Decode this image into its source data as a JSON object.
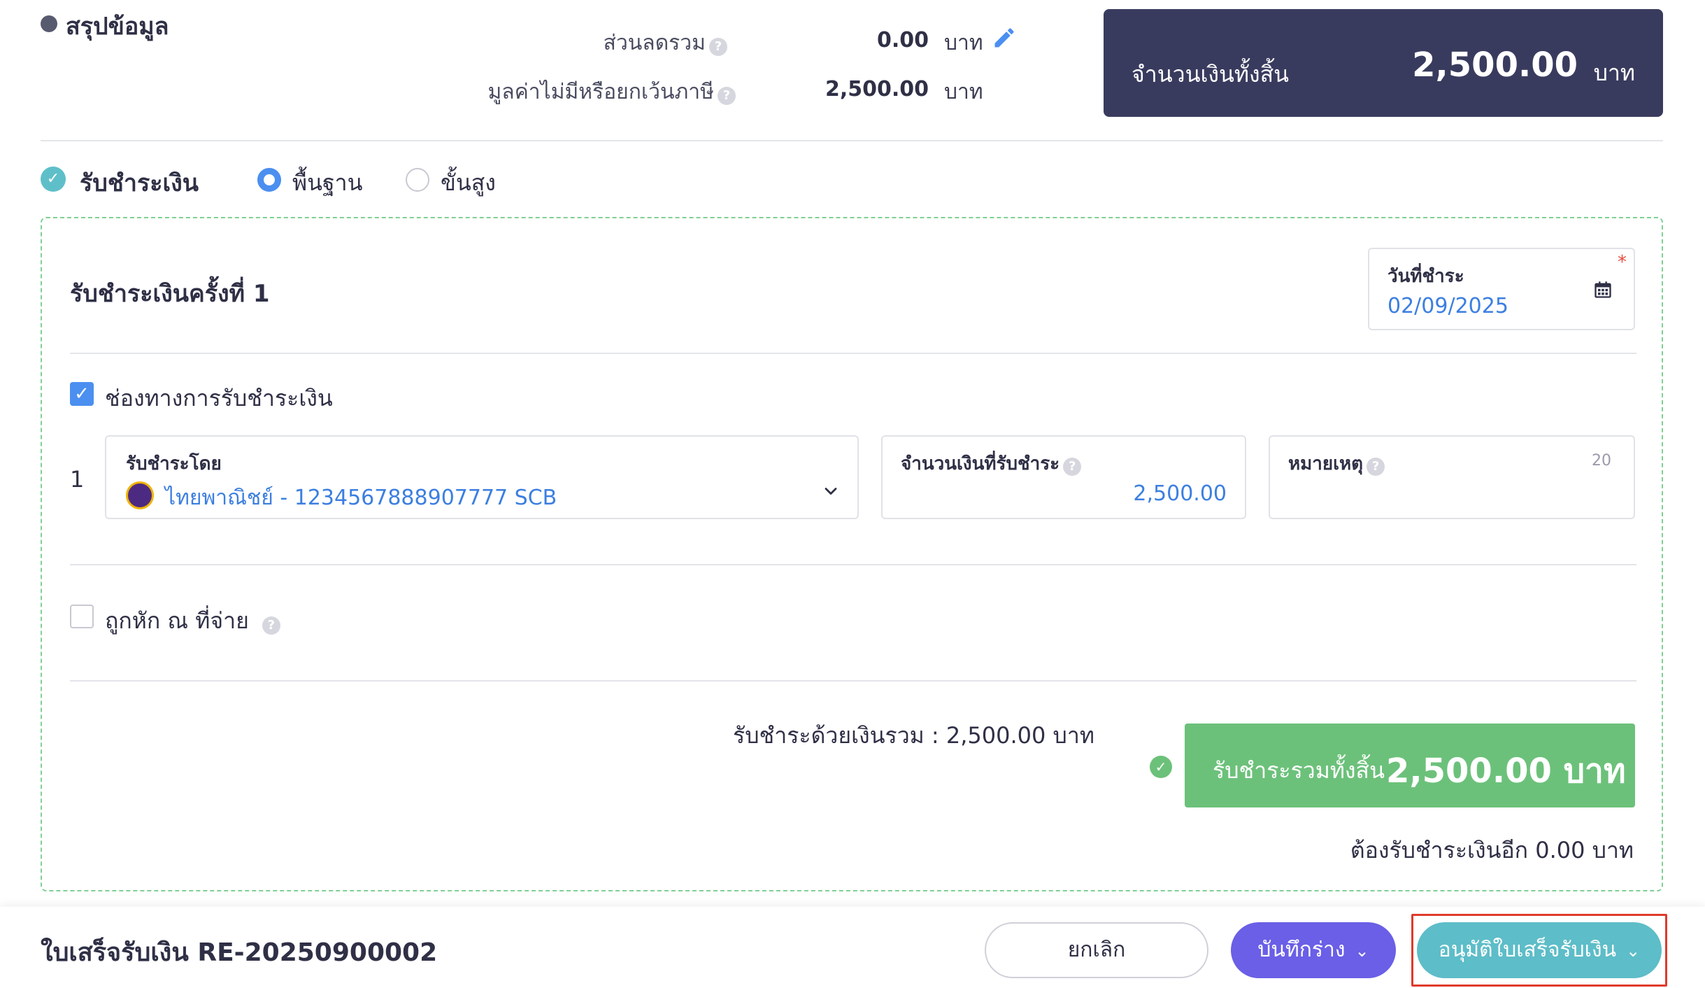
{
  "summary": {
    "title": "สรุปข้อมูล",
    "discount_label": "ส่วนลดรวม",
    "discount_value": "0.00",
    "discount_unit": "บาท",
    "nonvat_label": "มูลค่าไม่มีหรือยกเว้นภาษี",
    "nonvat_value": "2,500.00",
    "nonvat_unit": "บาท",
    "grand_label": "จำนวนเงินทั้งสิ้น",
    "grand_value": "2,500.00",
    "grand_unit": "บาท",
    "help_glyph": "?"
  },
  "payment_mode": {
    "title": "รับชำระเงิน",
    "option_basic": "พื้นฐาน",
    "option_advanced": "ขั้นสูง",
    "selected": "พื้นฐาน"
  },
  "payment_card": {
    "title": "รับชำระเงินครั้งที่ 1",
    "date_label": "วันที่ชำระ",
    "date_value": "02/09/2025",
    "required_mark": "*",
    "channel_label": "ช่องทางการรับชำระเงิน",
    "channel_checked": true,
    "rows": [
      {
        "index": "1",
        "method_label": "รับชำระโดย",
        "method_value": "ไทยพาณิชย์ - 1234567888907777 SCB",
        "amount_label": "จำนวนเงินที่รับชำระ",
        "amount_value": "2,500.00",
        "note_label": "หมายเหตุ",
        "note_counter": "20"
      }
    ],
    "withholding_label": "ถูกหัก ณ ที่จ่าย",
    "withholding_checked": false,
    "cash_total_text": "รับชำระด้วยเงินรวม : 2,500.00 บาท",
    "total_label": "รับชำระรวมทั้งสิ้น",
    "total_value": "2,500.00 บาท",
    "remaining_text": "ต้องรับชำระเงินอีก 0.00 บาท"
  },
  "bottom_bar": {
    "doc_title": "ใบเสร็จรับเงิน RE-20250900002",
    "cancel_label": "ยกเลิก",
    "draft_label": "บันทึกร่าง",
    "approve_label": "อนุมัติใบเสร็จรับเงิน"
  },
  "colors": {
    "grand_box": "#393b5e",
    "accent_blue": "#4b8ff0",
    "success_green": "#6cc17a",
    "draft_purple": "#6a5fe6",
    "approve_teal": "#5dbdc8",
    "highlight_red": "#e03a2c"
  },
  "icons": [
    "pencil-icon",
    "help-icon",
    "check-circle-icon",
    "calendar-icon",
    "chevron-down-icon",
    "checkbox-icon",
    "scb-bank-logo"
  ]
}
